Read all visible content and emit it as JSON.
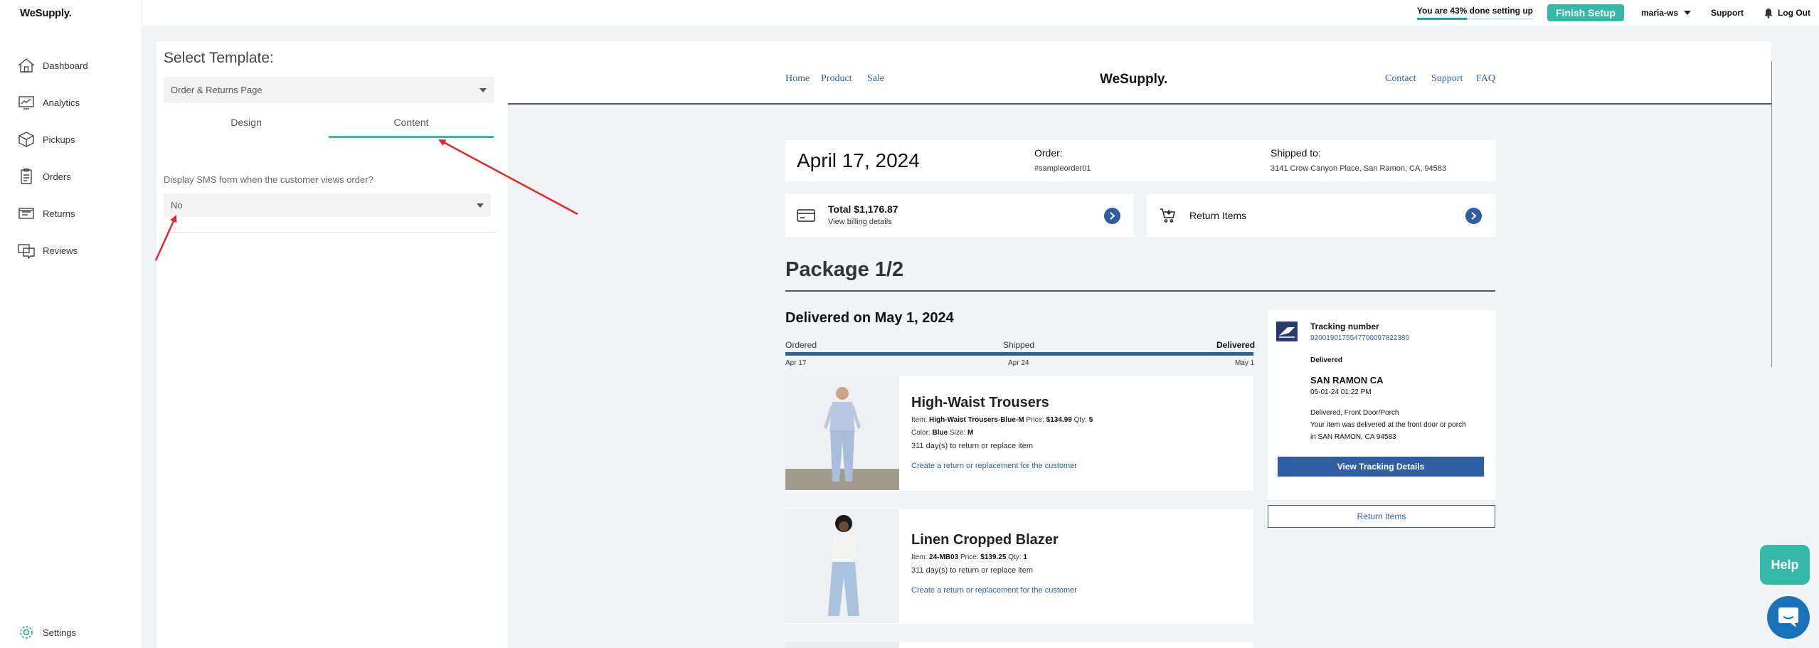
{
  "app": {
    "logo": "WeSupply."
  },
  "sidebar": {
    "items": [
      {
        "label": "Dashboard",
        "icon": "home-icon"
      },
      {
        "label": "Analytics",
        "icon": "analytics-icon"
      },
      {
        "label": "Pickups",
        "icon": "box-icon"
      },
      {
        "label": "Orders",
        "icon": "clipboard-icon"
      },
      {
        "label": "Returns",
        "icon": "returns-icon"
      },
      {
        "label": "Reviews",
        "icon": "reviews-icon"
      }
    ],
    "settings_label": "Settings"
  },
  "topbar": {
    "progress_text": "You are 43% done setting up",
    "progress_fraction": 0.43,
    "finish_label": "Finish Setup",
    "user": "maria-ws",
    "support": "Support",
    "logout": "Log Out"
  },
  "panel": {
    "title": "Select Template:",
    "template_value": "Order & Returns Page",
    "tabs": [
      "Design",
      "Content"
    ],
    "active_tab": "Content",
    "sms_label": "Display SMS form when the customer views order?",
    "sms_value": "No"
  },
  "preview": {
    "nav_left": [
      "Home",
      "Product",
      "Sale"
    ],
    "logo": "WeSupply.",
    "nav_right": [
      "Contact",
      "Support",
      "FAQ"
    ],
    "order_date": "April 17, 2024",
    "order_label": "Order:",
    "order_number": "#sampleorder01",
    "shipped_label": "Shipped to:",
    "shipped_address": "3141 Crow Canyon Place, San Ramon, CA, 94583",
    "total": "Total $1,176.87",
    "billing": "View billing details",
    "return_items": "Return Items",
    "package_title": "Package 1/2",
    "delivered_title": "Delivered on May 1, 2024",
    "timeline": {
      "labels": [
        "Ordered",
        "Shipped",
        "Delivered"
      ],
      "dates": [
        "Apr 17",
        "Apr 24",
        "May 1"
      ]
    },
    "products": [
      {
        "title": "High-Waist Trousers",
        "item_label": "Item:",
        "item": "High-Waist Trousers-Blue-M",
        "price_label": "Price:",
        "price": "$134.99",
        "qty_label": "Qty:",
        "qty": "5",
        "color_label": "Color:",
        "color": "Blue",
        "size_label": "Size:",
        "size": "M",
        "days": "311 day(s) to return or replace item",
        "link": "Create a return or replacement for the customer"
      },
      {
        "title": "Linen Cropped Blazer",
        "item_label": "Item:",
        "item": "24-MB03",
        "price_label": "Price:",
        "price": "$139.25",
        "qty_label": "Qty:",
        "qty": "1",
        "days": "311 day(s) to return or replace item",
        "link": "Create a return or replacement for the customer"
      }
    ],
    "tracking": {
      "label": "Tracking number",
      "number": "9200190175547700097822380",
      "status": "Delivered",
      "city": "SAN RAMON CA",
      "timestamp": "05-01-24 01:22 PM",
      "detail_1": "Delivered, Front Door/Porch",
      "detail_2": "Your item was delivered at the front door or porch",
      "detail_3": "in SAN RAMON, CA 94583",
      "button": "View Tracking Details"
    },
    "return_items_button": "Return Items"
  },
  "help_label": "Help",
  "colors": {
    "accent": "#36b8a8",
    "link": "#2f5fa0",
    "annotation": "#e8232a"
  }
}
